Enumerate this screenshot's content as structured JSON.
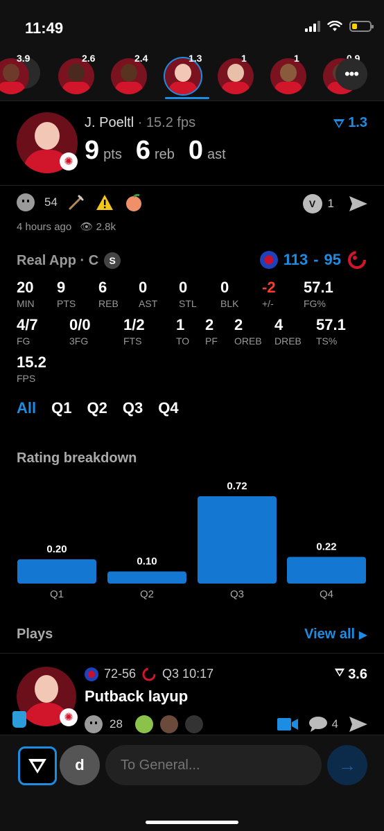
{
  "status": {
    "time": "11:49",
    "battery_level": 0.3
  },
  "strip": {
    "players": [
      {
        "score": "3.9",
        "skin": "#6e3a2a"
      },
      {
        "score": "2.6",
        "skin": "#4a2a1e"
      },
      {
        "score": "2.4",
        "skin": "#5a3220"
      },
      {
        "score": "1.3",
        "skin": "#f2c7b5",
        "selected": true
      },
      {
        "score": "1",
        "skin": "#e8bfa8"
      },
      {
        "score": "1",
        "skin": "#8a5a3c"
      },
      {
        "score": "0.9",
        "skin": "#5a3a2a"
      }
    ]
  },
  "player": {
    "name": "J. Poeltl",
    "fps_label": " · 15.2 fps",
    "pts": "9",
    "pts_label": "pts",
    "reb": "6",
    "reb_label": "reb",
    "ast": "0",
    "ast_label": "ast",
    "rating": "1.3"
  },
  "reactions": {
    "laugh_count": "54",
    "time_ago": "4 hours ago",
    "views": "2.8k",
    "votes_count": "1"
  },
  "box": {
    "league": "Real App · C",
    "badge": "S",
    "score_home": "113",
    "score_sep": "-",
    "score_away": "95",
    "row1": [
      {
        "v": "20",
        "k": "MIN"
      },
      {
        "v": "9",
        "k": "PTS"
      },
      {
        "v": "6",
        "k": "REB"
      },
      {
        "v": "0",
        "k": "AST"
      },
      {
        "v": "0",
        "k": "STL"
      },
      {
        "v": "0",
        "k": "BLK"
      },
      {
        "v": "-2",
        "k": "+/-",
        "neg": true
      },
      {
        "v": "57.1",
        "k": "FG%"
      }
    ],
    "row2": [
      {
        "v": "4/7",
        "k": "FG"
      },
      {
        "v": "0/0",
        "k": "3FG"
      },
      {
        "v": "1/2",
        "k": "FTS"
      },
      {
        "v": "1",
        "k": "TO"
      },
      {
        "v": "2",
        "k": "PF"
      },
      {
        "v": "2",
        "k": "OREB"
      },
      {
        "v": "4",
        "k": "DREB"
      },
      {
        "v": "57.1",
        "k": "TS%"
      }
    ],
    "row3": [
      {
        "v": "15.2",
        "k": "FPS"
      }
    ]
  },
  "quarter_tabs": [
    "All",
    "Q1",
    "Q2",
    "Q3",
    "Q4"
  ],
  "rating_breakdown": {
    "title": "Rating breakdown"
  },
  "chart_data": {
    "type": "bar",
    "categories": [
      "Q1",
      "Q2",
      "Q3",
      "Q4"
    ],
    "values": [
      0.2,
      0.1,
      0.72,
      0.22
    ],
    "value_labels": [
      "0.20",
      "0.10",
      "0.72",
      "0.22"
    ],
    "ylim": [
      0,
      0.72
    ],
    "color": "#1478d2",
    "grid": false
  },
  "plays": {
    "title": "Plays",
    "view_all": "View all",
    "items": [
      {
        "score": "72-56",
        "clock": "Q3 10:17",
        "rating": "3.6",
        "title": "Putback layup",
        "laugh_count": "28",
        "comments": "4"
      }
    ]
  },
  "composer": {
    "avatar_letter": "d",
    "placeholder": "To General..."
  },
  "colors": {
    "accent": "#1c8de3",
    "negative": "#ff3b30",
    "raptors": "#d1162c"
  }
}
